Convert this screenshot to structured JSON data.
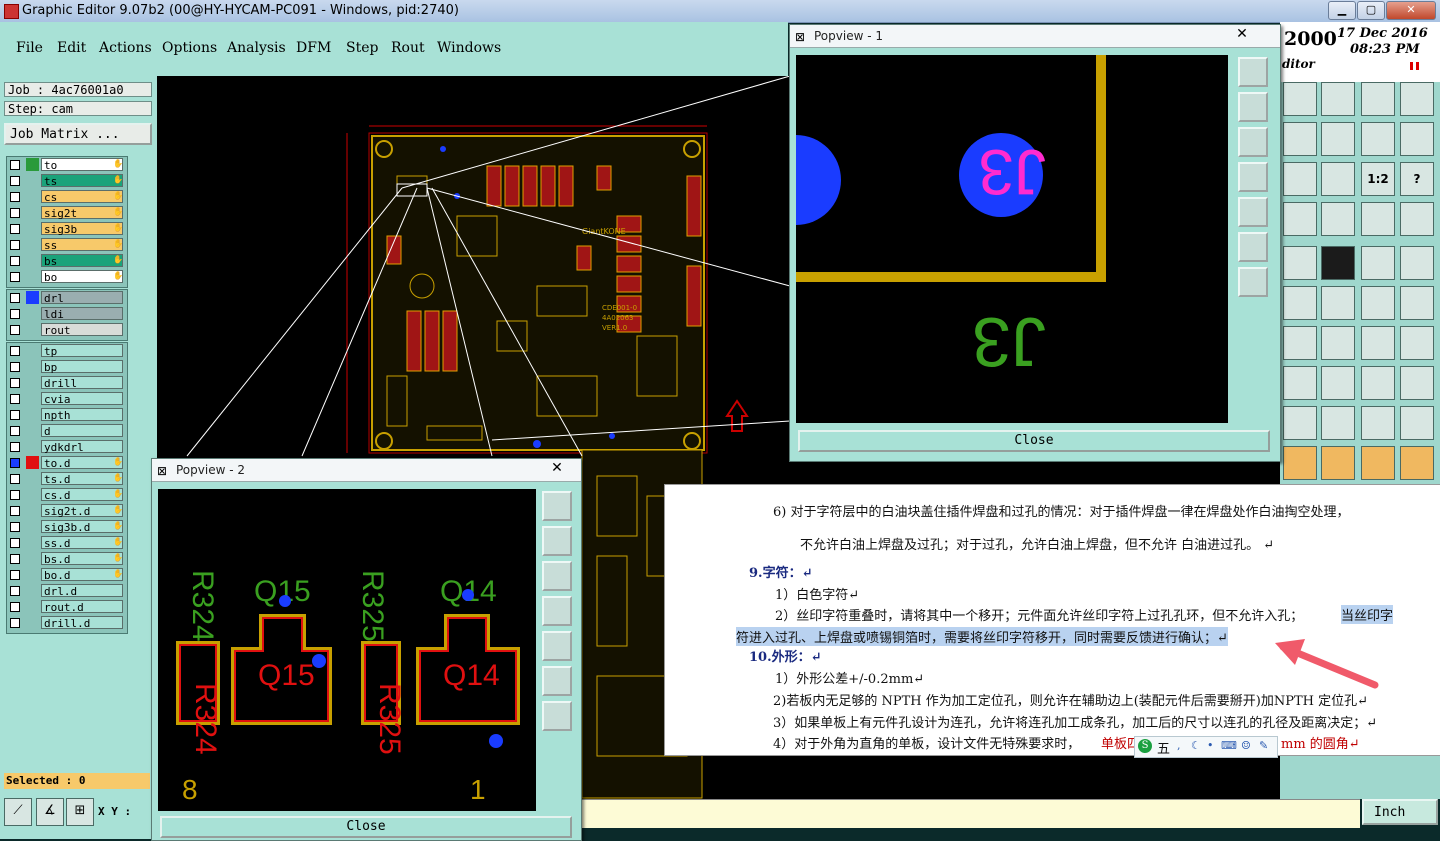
{
  "window": {
    "title": "Graphic Editor 9.07b2 (00@HY-HYCAM-PC091 - Windows, pid:2740)"
  },
  "menu": [
    "File",
    "Edit",
    "Actions",
    "Options",
    "Analysis",
    "DFM",
    "Step",
    "Rout",
    "Windows"
  ],
  "job": {
    "job_label": "Job : 4ac76001a0",
    "step_label": "Step: cam",
    "job_matrix": "Job Matrix ..."
  },
  "layers_board": [
    {
      "name": "to",
      "color": "#2a9a3a",
      "bg": "#ffffff"
    },
    {
      "name": "ts",
      "color": "#2a9a3a",
      "bg": "#1aa37a"
    },
    {
      "name": "cs",
      "color": "#2a9a3a",
      "bg": "#f7c96a"
    },
    {
      "name": "sig2t",
      "color": "#2a9a3a",
      "bg": "#f7c96a"
    },
    {
      "name": "sig3b",
      "color": "#2a9a3a",
      "bg": "#f7c96a"
    },
    {
      "name": "ss",
      "color": "#2a9a3a",
      "bg": "#f7c96a"
    },
    {
      "name": "bs",
      "color": "#2a9a3a",
      "bg": "#1aa37a"
    },
    {
      "name": "bo",
      "color": "#2a9a3a",
      "bg": "#ffffff"
    }
  ],
  "layers_drill": [
    {
      "name": "drl",
      "bg": "#9aaeb0"
    },
    {
      "name": "ldi",
      "bg": "#9aaeb0"
    },
    {
      "name": "rout",
      "bg": "#d8dcd8"
    }
  ],
  "layers_misc": [
    "tp",
    "bp",
    "drill",
    "cvia",
    "npth",
    "d",
    "ydkdrl",
    "to.d",
    "ts.d",
    "cs.d",
    "sig2t.d",
    "sig3b.d",
    "ss.d",
    "bs.d",
    "bo.d",
    "drl.d",
    "rout.d",
    "drill.d"
  ],
  "status": {
    "selected": "Selected : 0",
    "xy_label": "X Y :",
    "units": "Inch"
  },
  "clock": {
    "year": "2000",
    "date": "17 Dec 2016",
    "time": "08:23 PM",
    "label": "ditor"
  },
  "popview1": {
    "title": "Popview - 1",
    "close": "Close",
    "labels": [
      "J3",
      "J3"
    ]
  },
  "popview2": {
    "title": "Popview - 2",
    "close": "Close",
    "labels": [
      "R324",
      "Q15",
      "R325",
      "Q14",
      "Q15",
      "R324",
      "R325",
      "Q14",
      "8",
      "1"
    ]
  },
  "board": {
    "label1": "CDE001-0",
    "label2": "4A02063",
    "label3": "VER1.0",
    "logo": "GiantKONE"
  },
  "doc": {
    "line1": "6)  对于字符层中的白油块盖住插件焊盘和过孔的情况：对于插件焊盘一律在焊盘处作白油掏空处理，",
    "line2": "不允许白油上焊盘及过孔；对于过孔，允许白油上焊盘，但不允许 白油进过孔。 ↵",
    "h9": "9.字符：↵",
    "l3": "1）白色字符↵",
    "l4a": "2）丝印字符重叠时，请将其中一个移开；元件面允许丝印字符上过孔孔环，但不允许入孔；",
    "l4b": "当丝印字",
    "l5": "符进入过孔、上焊盘或喷锡铜箔时，需要将丝印字符移开，同时需要反馈进行确认；↵",
    "h10": "10.外形：↵",
    "l6": "1）外形公差+/-0.2mm↵",
    "l7": "2)若板内无足够的 NPTH 作为加工定位孔，则允许在辅助边上(装配元件后需要掰开)加NPTH 定位孔↵",
    "l8": "3）如果单板上有元件孔设计为连孔，允许将连孔加工成条孔，加工后的尺寸以连孔的孔径及距离决定；↵",
    "l9a": "4）对于外角为直角的单板，设计文件无特殊要求时，",
    "l9b": "单板四",
    "l9c": "mm 的圆角↵",
    "ime": "五"
  }
}
